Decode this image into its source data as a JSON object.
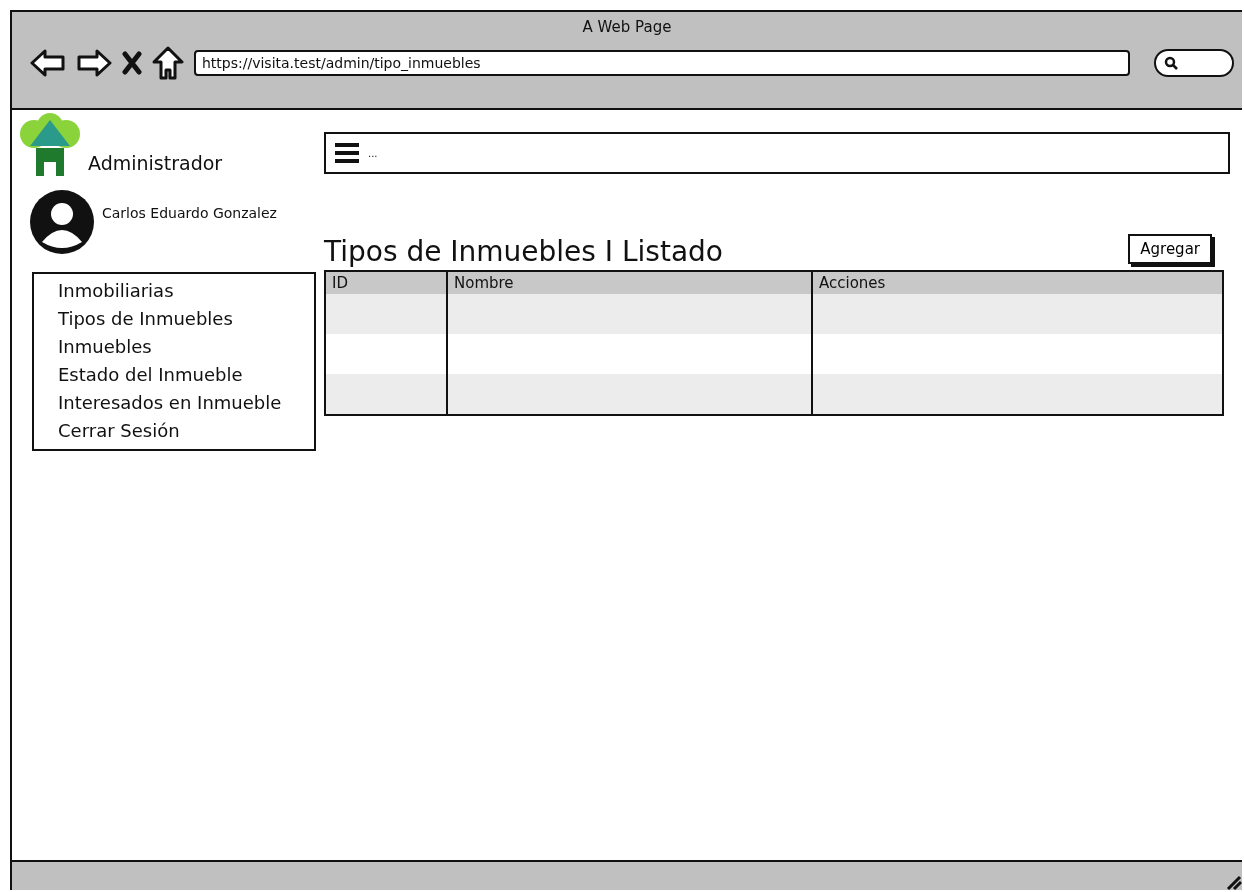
{
  "window": {
    "title": "A Web Page"
  },
  "browser": {
    "url": "https://visita.test/admin/tipo_inmuebles"
  },
  "sidebar": {
    "brand": "Administrador",
    "user": "Carlos Eduardo Gonzalez",
    "items": [
      {
        "label": "Inmobiliarias"
      },
      {
        "label": "Tipos de Inmuebles"
      },
      {
        "label": "Inmuebles"
      },
      {
        "label": "Estado del Inmueble"
      },
      {
        "label": "Interesados en Inmueble"
      },
      {
        "label": "Cerrar Sesión"
      }
    ]
  },
  "navbar": {
    "text": "..."
  },
  "page": {
    "title": "Tipos de Inmuebles I Listado",
    "add_button": "Agregar"
  },
  "table": {
    "columns": [
      "ID",
      "Nombre",
      "Acciones"
    ]
  }
}
